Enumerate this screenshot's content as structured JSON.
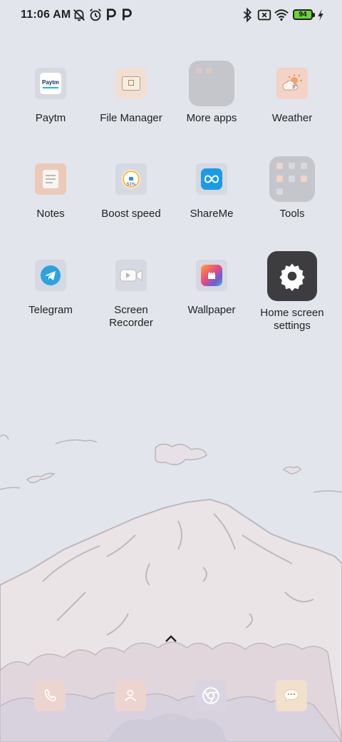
{
  "status_bar": {
    "time": "11:06 AM",
    "battery_level": "94",
    "icons": [
      "notifications-off-icon",
      "alarm-icon",
      "paytm-p-icon",
      "paytm-p-icon",
      "bluetooth-icon",
      "no-sim-icon",
      "wifi-icon",
      "battery-icon",
      "charging-bolt-icon"
    ]
  },
  "apps": [
    {
      "label": "Paytm",
      "icon": "paytm-icon"
    },
    {
      "label": "File Manager",
      "icon": "file-manager-icon"
    },
    {
      "label": "More apps",
      "icon": "folder-icon"
    },
    {
      "label": "Weather",
      "icon": "weather-icon"
    },
    {
      "label": "Notes",
      "icon": "notes-icon"
    },
    {
      "label": "Boost speed",
      "icon": "boost-speed-icon"
    },
    {
      "label": "ShareMe",
      "icon": "shareme-icon"
    },
    {
      "label": "Tools",
      "icon": "folder-icon"
    },
    {
      "label": "Telegram",
      "icon": "telegram-icon"
    },
    {
      "label": "Screen Recorder",
      "icon": "screen-recorder-icon"
    },
    {
      "label": "Wallpaper",
      "icon": "wallpaper-icon"
    },
    {
      "label": "Home screen settings",
      "icon": "gear-icon"
    }
  ],
  "icon_text": {
    "paytm": "Paytm",
    "weather_temp": "3°",
    "boost_pct": "51%"
  },
  "dock": [
    "phone-icon",
    "contacts-icon",
    "chrome-icon",
    "messages-icon"
  ],
  "colors": {
    "background": "#e3e5ec",
    "battery_green": "#6cd33a",
    "telegram_blue": "#2aa3df",
    "shareme_blue": "#1a9be8",
    "settings_dark": "#3d3d3f"
  }
}
